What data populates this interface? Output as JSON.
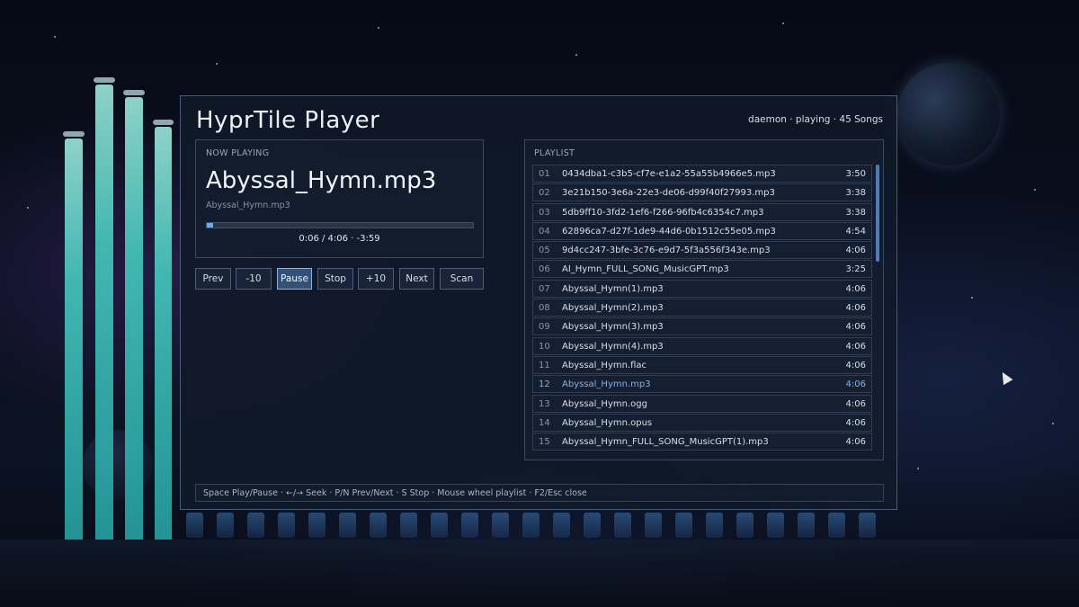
{
  "app": {
    "title": "HyprTile Player",
    "status": "daemon · playing · 45 Songs"
  },
  "now_playing": {
    "label": "NOW PLAYING",
    "title": "Abyssal_Hymn.mp3",
    "subtitle": "Abyssal_Hymn.mp3",
    "time": "0:06 / 4:06 · -3:59",
    "progress_fraction": 0.024
  },
  "controls": [
    {
      "label": "Prev",
      "active": false
    },
    {
      "label": "-10",
      "active": false
    },
    {
      "label": "Pause",
      "active": true
    },
    {
      "label": "Stop",
      "active": false
    },
    {
      "label": "+10",
      "active": false
    },
    {
      "label": "Next",
      "active": false
    },
    {
      "label": "Scan",
      "active": false
    }
  ],
  "playlist": {
    "label": "PLAYLIST",
    "current_index": 12,
    "items": [
      {
        "num": "01",
        "name": "0434dba1-c3b5-cf7e-e1a2-55a55b4966e5.mp3",
        "duration": "3:50"
      },
      {
        "num": "02",
        "name": "3e21b150-3e6a-22e3-de06-d99f40f27993.mp3",
        "duration": "3:38"
      },
      {
        "num": "03",
        "name": "5db9ff10-3fd2-1ef6-f266-96fb4c6354c7.mp3",
        "duration": "3:38"
      },
      {
        "num": "04",
        "name": "62896ca7-d27f-1de9-44d6-0b1512c55e05.mp3",
        "duration": "4:54"
      },
      {
        "num": "05",
        "name": "9d4cc247-3bfe-3c76-e9d7-5f3a556f343e.mp3",
        "duration": "4:06"
      },
      {
        "num": "06",
        "name": "AI_Hymn_FULL_SONG_MusicGPT.mp3",
        "duration": "3:25"
      },
      {
        "num": "07",
        "name": "Abyssal_Hymn(1).mp3",
        "duration": "4:06"
      },
      {
        "num": "08",
        "name": "Abyssal_Hymn(2).mp3",
        "duration": "4:06"
      },
      {
        "num": "09",
        "name": "Abyssal_Hymn(3).mp3",
        "duration": "4:06"
      },
      {
        "num": "10",
        "name": "Abyssal_Hymn(4).mp3",
        "duration": "4:06"
      },
      {
        "num": "11",
        "name": "Abyssal_Hymn.flac",
        "duration": "4:06"
      },
      {
        "num": "12",
        "name": "Abyssal_Hymn.mp3",
        "duration": "4:06"
      },
      {
        "num": "13",
        "name": "Abyssal_Hymn.ogg",
        "duration": "4:06"
      },
      {
        "num": "14",
        "name": "Abyssal_Hymn.opus",
        "duration": "4:06"
      },
      {
        "num": "15",
        "name": "Abyssal_Hymn_FULL_SONG_MusicGPT(1).mp3",
        "duration": "4:06"
      }
    ]
  },
  "hints": "Space Play/Pause · ←/→ Seek · P/N Prev/Next · S Stop · Mouse wheel playlist · F2/Esc close",
  "colors": {
    "accent": "#6fa7e6",
    "current_track": "#7fb2ec",
    "visualizer": "#46c8be"
  }
}
